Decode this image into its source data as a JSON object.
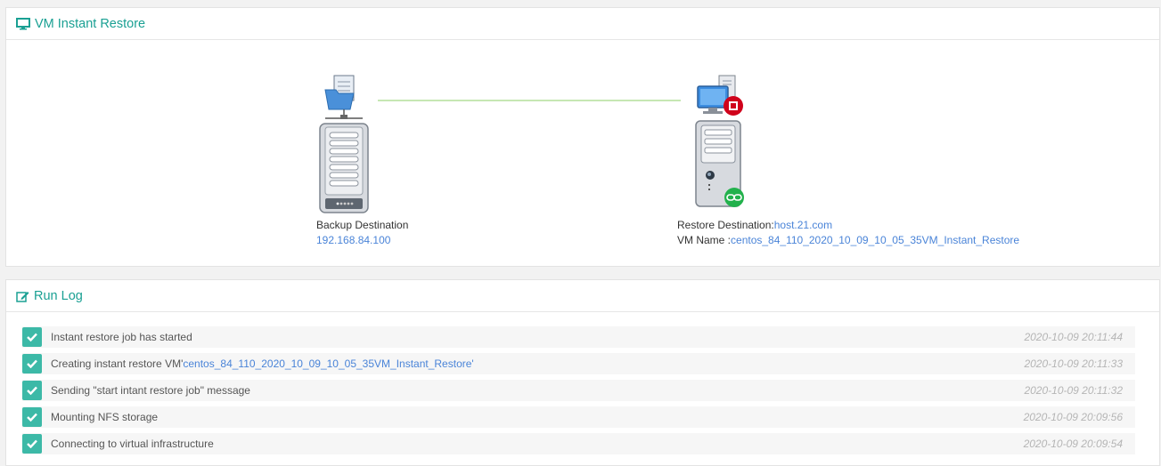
{
  "restore_panel": {
    "title": "VM Instant Restore",
    "title_icon": "monitor-icon",
    "backup": {
      "label": "Backup Destination",
      "ip": "192.168.84.100"
    },
    "restore": {
      "label": "Restore Destination:",
      "host": "host.21.com",
      "vm_label": "VM Name :",
      "vm_name": "centos_84_110_2020_10_09_10_05_35VM_Instant_Restore"
    }
  },
  "run_log": {
    "title": "Run Log",
    "title_icon": "edit-icon",
    "entries": [
      {
        "message": "Instant restore job has started",
        "link": "",
        "suffix": "",
        "time": "2020-10-09 20:11:44"
      },
      {
        "message": "Creating instant restore VM'",
        "link": "centos_84_110_2020_10_09_10_05_35VM_Instant_Restore",
        "suffix": "'",
        "time": "2020-10-09 20:11:33"
      },
      {
        "message": "Sending \"start intant restore job\" message",
        "link": "",
        "suffix": "",
        "time": "2020-10-09 20:11:32"
      },
      {
        "message": "Mounting NFS storage",
        "link": "",
        "suffix": "",
        "time": "2020-10-09 20:09:56"
      },
      {
        "message": "Connecting to virtual infrastructure",
        "link": "",
        "suffix": "",
        "time": "2020-10-09 20:09:54"
      }
    ]
  },
  "colors": {
    "accent": "#1aa093",
    "link": "#4a84d8",
    "check": "#3cb9a7",
    "stop_badge": "#d0021b",
    "link_badge": "#22b14c",
    "connection_line": "#c6e7b3"
  }
}
